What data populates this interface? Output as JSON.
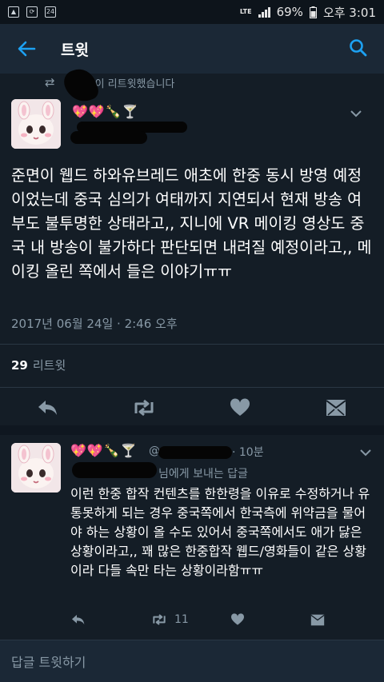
{
  "status_bar": {
    "network": "LTE",
    "battery": "69%",
    "time": "오후 3:01",
    "notif_badge": "24"
  },
  "app_bar": {
    "title": "트윗"
  },
  "retweet_context": {
    "text": "이 리트윗했습니다"
  },
  "tweet": {
    "name_emoji": "💖💖🍾🍸",
    "text": "준면이 웹드 하와유브레드 애초에 한중 동시 방영 예정이었는데 중국 심의가 여태까지 지연되서 현재 방송 여부도 불투명한 상태라고,, 지니에 VR 메이킹 영상도 중국 내 방송이 불가하다 판단되면 내려질 예정이라고,, 메이킹 올린 쪽에서 들은 이야기ㅠㅠ",
    "timestamp": "2017년 06월 24일 · 2:46 오후",
    "retweet_count": "29",
    "retweet_label": "리트윗"
  },
  "reply": {
    "name_emoji": "💖💖🍾🍸",
    "handle": "@",
    "time": "· 10분",
    "reply_to": "님에게 보내는 답글",
    "text": "이런 한중 합작 컨텐츠를 한한령을 이유로 수정하거나 유통못하게 되는 경우 중국쪽에서 한국측에 위약금을 물어야 하는 상황이 올 수도 있어서 중국쪽에서도 애가 닳은 상황이라고,, 꽤 많은 한중합작 웹드/영화들이 같은 상황이라 다들 속만 타는 상황이라함ㅠㅠ",
    "retweet_count": "11"
  },
  "compose": {
    "placeholder": "답글 트윗하기"
  },
  "colors": {
    "background": "#141d26",
    "app_bar": "#1b2836",
    "accent": "#1da1f2",
    "secondary_text": "#8899a6"
  }
}
